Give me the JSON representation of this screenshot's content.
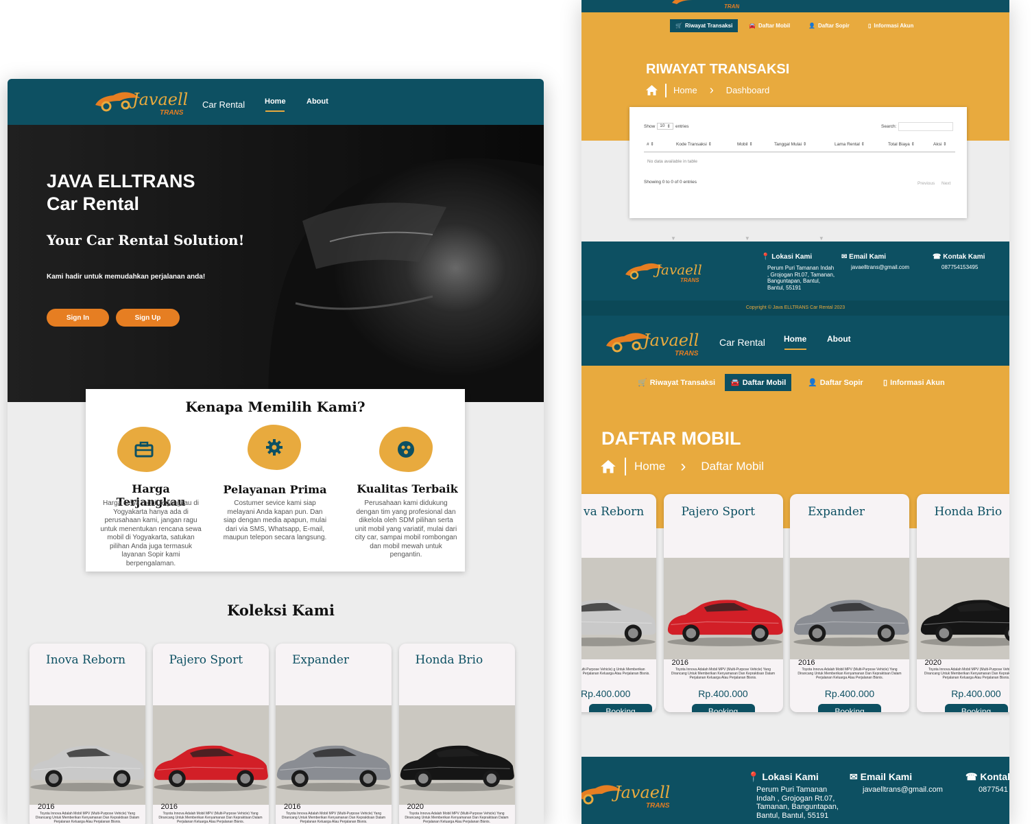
{
  "brand": {
    "logo_text": "Javaell",
    "logo_sub": "TRANS",
    "app_label": "Car Rental"
  },
  "nav": {
    "home": "Home",
    "about": "About"
  },
  "hero": {
    "title_line1": "JAVA ELLTRANS",
    "title_line2": "Car Rental",
    "tagline": "Your Car Rental Solution!",
    "subtitle": "Kami hadir untuk memudahkan perjalanan anda!",
    "signin": "Sign In",
    "signup": "Sign Up"
  },
  "why": {
    "heading": "Kenapa Memilih Kami?",
    "features": [
      {
        "icon": "briefcase-icon",
        "title": "Harga Terjangkau",
        "desc": "Harga sewa mobil terjangkau di Yogyakarta hanya ada di perusahaan kami, jangan ragu untuk menentukan rencana sewa mobil di Yogyakarta, satukan pilihan Anda juga termasuk layanan Sopir kami berpengalaman."
      },
      {
        "icon": "gear-icon",
        "title": "Pelayanan Prima",
        "desc": "Costumer sevice kami siap melayani Anda kapan pun. Dan siap dengan media apapun, mulai dari via SMS, Whatsapp, E-mail, maupun telepon secara langsung."
      },
      {
        "icon": "steering-wheel-icon",
        "title": "Kualitas Terbaik",
        "desc": "Perusahaan kami didukung dengan tim yang profesional dan dikelola oleh SDM pilihan serta unit mobil yang variatif, mulai dari city car, sampai mobil rombongan dan mobil mewah untuk pengantin."
      }
    ]
  },
  "collection": {
    "heading": "Koleksi Kami",
    "cars": [
      {
        "name": "Inova Reborn",
        "year": "2016",
        "color": "#c9c9c9",
        "desc": "Toyota Innova Adalah Mobil MPV (Multi-Purpose Vehicle) Yang Dirancang Untuk Memberikan Kenyamanan Dan Kepraktisan Dalam Perjalanan Keluarga Atau Perjalanan Bisnis.",
        "price": "Rp.400.000",
        "book": "Booking"
      },
      {
        "name": "Pajero Sport",
        "year": "2016",
        "color": "#d21f27",
        "desc": "Toyota Innova Adalah Mobil MPV (Multi-Purpose Vehicle) Yang Dirancang Untuk Memberikan Kenyamanan Dan Kepraktisan Dalam Perjalanan Keluarga Atau Perjalanan Bisnis.",
        "price": "Rp.400.000",
        "book": "Booking"
      },
      {
        "name": "Expander",
        "year": "2016",
        "color": "#8a8d93",
        "desc": "Toyota Innova Adalah Mobil MPV (Multi-Purpose Vehicle) Yang Dirancang Untuk Memberikan Kenyamanan Dan Kepraktisan Dalam Perjalanan Keluarga Atau Perjalanan Bisnis.",
        "price": "Rp.400.000",
        "book": "Booking"
      },
      {
        "name": "Honda Brio",
        "year": "2020",
        "color": "#151515",
        "desc": "Toyota Innova Adalah Mobil MPV (Multi-Purpose Vehicle) Yang Dirancang Untuk Memberikan Kenyamanan Dan Kepraktisan Dalam Perjalanan Keluarga Atau Perjalanan Bisnis.",
        "price": "Rp.400.000",
        "book": "Booking"
      }
    ]
  },
  "subnav": {
    "riwayat": "Riwayat Transaksi",
    "daftar": "Daftar Mobil",
    "sopir": "Daftar Sopir",
    "akun": "Informasi Akun"
  },
  "riwayat": {
    "title": "RIWAYAT TRANSAKSI",
    "crumb_home": "Home",
    "crumb_current": "Dashboard",
    "show": "Show",
    "entries_value": "10",
    "entries": "entries",
    "search": "Search:",
    "columns": [
      "#",
      "Kode Transaksi",
      "Mobil",
      "Tanggal Mulai",
      "Lama Rental",
      "Total Biaya",
      "Aksi"
    ],
    "empty": "No data available in table",
    "info": "Showing 0 to 0 of 0 entries",
    "prev": "Previous",
    "next": "Next"
  },
  "footer": {
    "loc_title": "Lokasi Kami",
    "loc_text": "Perum Puri Tamanan Indah , Grojogan Rt.07, Tamanan, Banguntapan, Bantul, Bantul, 55191",
    "email_title": "Email Kami",
    "email": "javaelltrans@gmail.com",
    "contact_title": "Kontak Kami",
    "phone": "087754153495",
    "phone_partial": "0877541",
    "contact_partial": "Kontak",
    "copyright": "Copyright © Java ELLTRANS Car Rental 2023"
  },
  "daftar": {
    "title": "DAFTAR MOBIL",
    "crumb_home": "Home",
    "crumb_current": "Daftar Mobil",
    "first_card_partial": "va Reborn",
    "first_desc_partial": "adalah Mobil MPV (Multi-Purpose Vehicle) g Untuk Memberikan Kenyamanan Dan Dalam Perjalanan Keluarga Atau Perjalanan Bisnis.",
    "first_price_partial": "Rp.400.000"
  }
}
